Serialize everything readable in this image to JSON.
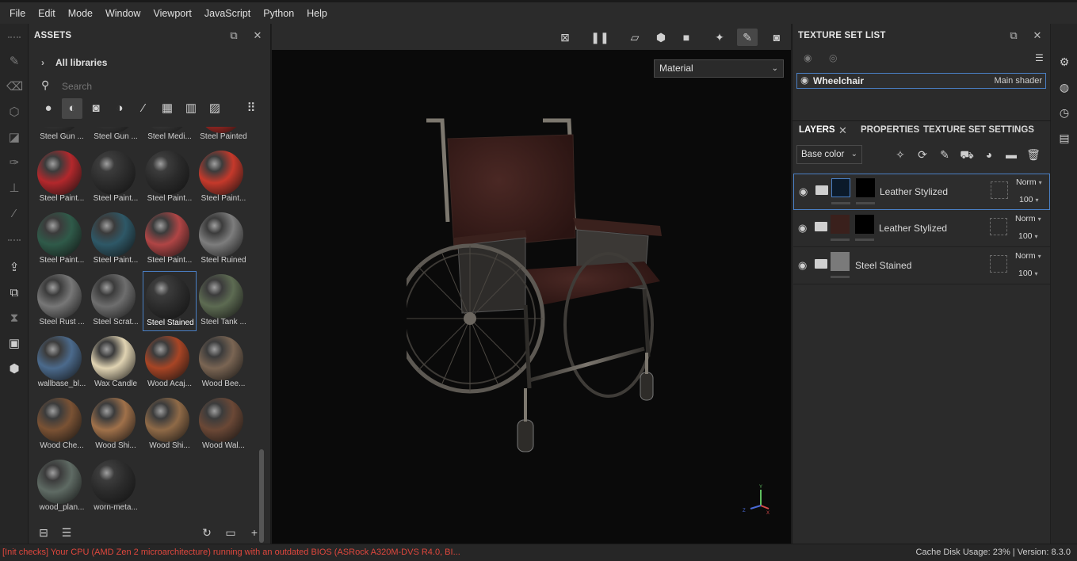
{
  "menubar": [
    "File",
    "Edit",
    "Mode",
    "Window",
    "Viewport",
    "JavaScript",
    "Python",
    "Help"
  ],
  "assets": {
    "title": "ASSETS",
    "libraries": "All libraries",
    "search_placeholder": "Search",
    "items": [
      {
        "label": "Steel Gun ...",
        "color": "#3a3a3a"
      },
      {
        "label": "Steel Gun ...",
        "color": "#3a3a3a"
      },
      {
        "label": "Steel Medi...",
        "color": "#3d3d3d"
      },
      {
        "label": "Steel Painted",
        "color": "#b22a24"
      },
      {
        "label": "Steel Paint...",
        "color": "#b3282c"
      },
      {
        "label": "Steel Paint...",
        "color": "#2d2d2d"
      },
      {
        "label": "Steel Paint...",
        "color": "#2a2a2a"
      },
      {
        "label": "Steel Paint...",
        "color": "#c5392b"
      },
      {
        "label": "Steel Paint...",
        "color": "#2f5a49"
      },
      {
        "label": "Steel Paint...",
        "color": "#2e5867"
      },
      {
        "label": "Steel Paint...",
        "color": "#b04545"
      },
      {
        "label": "Steel Ruined",
        "color": "#7d7d7d"
      },
      {
        "label": "Steel Rust ...",
        "color": "#777777"
      },
      {
        "label": "Steel Scrat...",
        "color": "#6e6e6e"
      },
      {
        "label": "Steel Stained",
        "color": "#2c2c2c"
      },
      {
        "label": "Steel Tank ...",
        "color": "#5d6b52"
      },
      {
        "label": "wallbase_bl...",
        "color": "#4b6a8c"
      },
      {
        "label": "Wax Candle",
        "color": "#e0d3b2"
      },
      {
        "label": "Wood Acaj...",
        "color": "#a84525"
      },
      {
        "label": "Wood Bee...",
        "color": "#7a6553"
      },
      {
        "label": "Wood Che...",
        "color": "#7a5234"
      },
      {
        "label": "Wood Shi...",
        "color": "#a0714a"
      },
      {
        "label": "Wood Shi...",
        "color": "#8f6a47"
      },
      {
        "label": "Wood Wal...",
        "color": "#6b4836"
      },
      {
        "label": "wood_plan...",
        "color": "#5f6b64"
      },
      {
        "label": "worn-meta...",
        "color": "#2b2b2b"
      }
    ],
    "selected_index": 14
  },
  "viewport": {
    "material_select": "Material"
  },
  "texture_set_list": {
    "title": "TEXTURE SET LIST",
    "item_name": "Wheelchair",
    "item_shader": "Main shader"
  },
  "tabs": {
    "layers": "LAYERS",
    "properties": "PROPERTIES",
    "texture_set_settings": "TEXTURE SET SETTINGS"
  },
  "channel_select": "Base color",
  "layers": [
    {
      "name": "Leather Stylized",
      "blend": "Norm",
      "opacity": "100",
      "thumb_color": "#0b1a2a",
      "selected": true
    },
    {
      "name": "Leather Stylized",
      "blend": "Norm",
      "opacity": "100",
      "thumb_color": "#3a201c",
      "selected": false
    },
    {
      "name": "Steel Stained",
      "blend": "Norm",
      "opacity": "100",
      "thumb_color": "#7a7a7a",
      "selected": false
    }
  ],
  "status": {
    "error": "[Init checks] Your CPU (AMD Zen 2 microarchitecture) running with an outdated BIOS (ASRock A320M-DVS R4.0, BI...",
    "cache": "Cache Disk Usage:   23% | Version: 8.3.0"
  }
}
